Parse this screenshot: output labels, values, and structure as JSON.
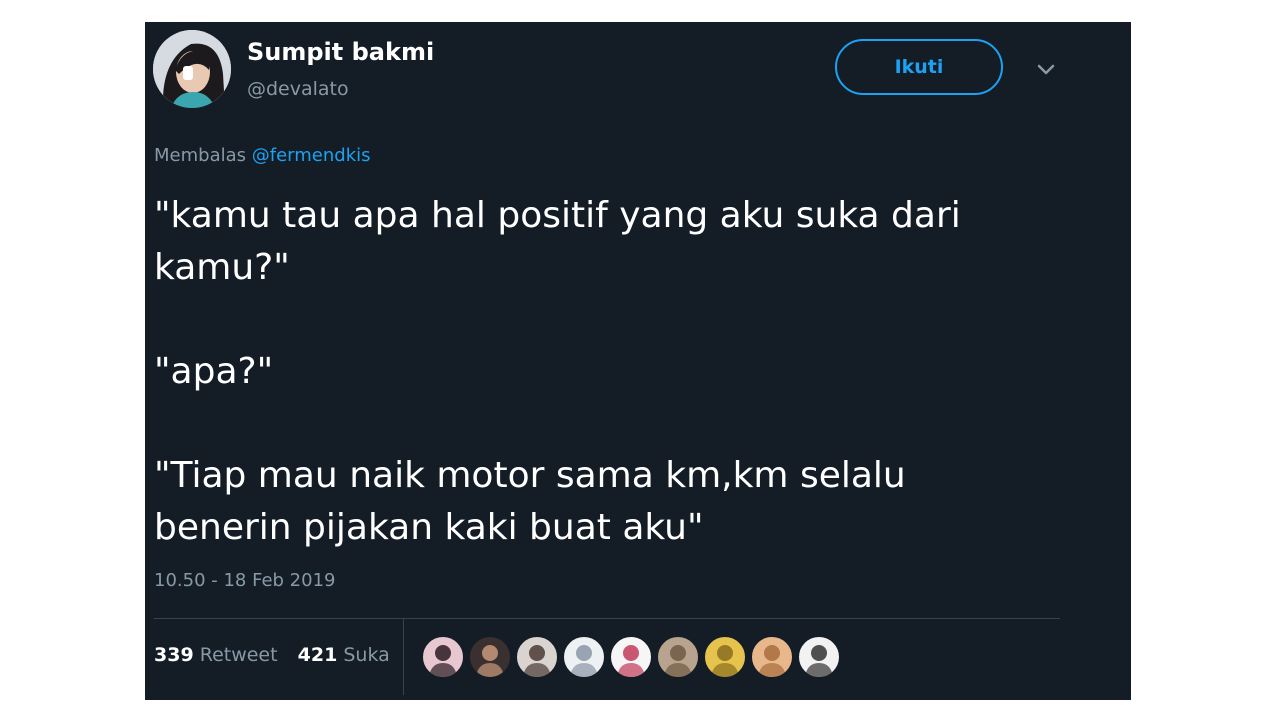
{
  "author": {
    "display_name": "Sumpit bakmi",
    "handle": "@devalato"
  },
  "follow_button": {
    "label": "Ikuti"
  },
  "reply": {
    "prefix": "Membalas",
    "mention": "@fermendkis"
  },
  "tweet": {
    "lines": [
      "\"kamu tau apa hal positif yang aku suka dari",
      "kamu?\"",
      "",
      "\"apa?\"",
      "",
      "\"Tiap mau naik motor sama km,km selalu",
      "benerin pijakan kaki buat aku\""
    ]
  },
  "timestamp": "10.50 - 18 Feb 2019",
  "stats": {
    "retweets": "339",
    "retweets_label": "Retweet",
    "likes": "421",
    "likes_label": "Suka"
  },
  "liker_avatars": [
    {
      "bg": "#e8c8d0",
      "fg": "#2a1a22"
    },
    {
      "bg": "#3b3030",
      "fg": "#c99a7a"
    },
    {
      "bg": "#d9d4cf",
      "fg": "#4a3a33"
    },
    {
      "bg": "#eef1f4",
      "fg": "#8a95a5"
    },
    {
      "bg": "#f6f6f6",
      "fg": "#c23b5a"
    },
    {
      "bg": "#b8a48e",
      "fg": "#6f5a45"
    },
    {
      "bg": "#e5c34d",
      "fg": "#8a6d1e"
    },
    {
      "bg": "#e8b88c",
      "fg": "#a86c3c"
    },
    {
      "bg": "#f2f2f2",
      "fg": "#333333"
    }
  ],
  "colors": {
    "background": "#141d26",
    "accent": "#1da1f2",
    "muted_text": "#8899a6",
    "divider": "#38444d"
  }
}
